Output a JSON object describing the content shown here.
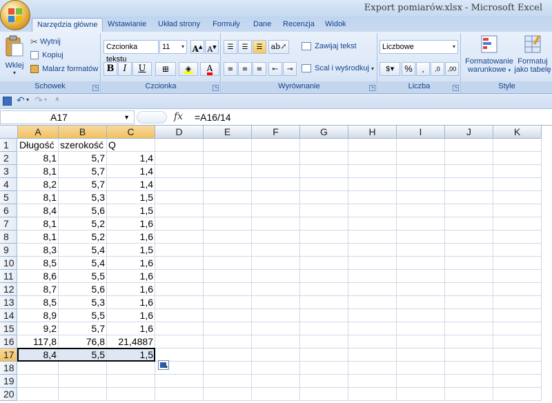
{
  "window": {
    "title": "Export pomiarów.xlsx - Microsoft Excel"
  },
  "tabs": [
    "Narzędzia główne",
    "Wstawianie",
    "Układ strony",
    "Formuły",
    "Dane",
    "Recenzja",
    "Widok"
  ],
  "ribbon": {
    "clipboard": {
      "paste": "Wklej",
      "cut": "Wytnij",
      "copy": "Kopiuj",
      "format_painter": "Malarz formatów",
      "label": "Schowek"
    },
    "font": {
      "name": "Czcionka tekstu",
      "size": "11",
      "label": "Czcionka",
      "bold": "B",
      "italic": "I",
      "underline": "U"
    },
    "alignment": {
      "wrap": "Zawijaj tekst",
      "merge": "Scal i wyśrodkuj",
      "label": "Wyrównanie"
    },
    "number": {
      "format": "Liczbowe",
      "percent": "%",
      "label": "Liczba"
    },
    "styles": {
      "conditional_line1": "Formatowanie",
      "conditional_line2": "warunkowe",
      "table_line1": "Formatuj",
      "table_line2": "jako tabelę",
      "label": "Style"
    }
  },
  "formula_bar": {
    "cell_ref": "A17",
    "fx": "fx",
    "formula": "=A16/14"
  },
  "columns": [
    "A",
    "B",
    "C",
    "D",
    "E",
    "F",
    "G",
    "H",
    "I",
    "J",
    "K"
  ],
  "rows": [
    {
      "n": "1",
      "a": "Długość",
      "b": "szerokość",
      "c": "Q"
    },
    {
      "n": "2",
      "a": "8,1",
      "b": "5,7",
      "c": "1,4"
    },
    {
      "n": "3",
      "a": "8,1",
      "b": "5,7",
      "c": "1,4"
    },
    {
      "n": "4",
      "a": "8,2",
      "b": "5,7",
      "c": "1,4"
    },
    {
      "n": "5",
      "a": "8,1",
      "b": "5,3",
      "c": "1,5"
    },
    {
      "n": "6",
      "a": "8,4",
      "b": "5,6",
      "c": "1,5"
    },
    {
      "n": "7",
      "a": "8,1",
      "b": "5,2",
      "c": "1,6"
    },
    {
      "n": "8",
      "a": "8,1",
      "b": "5,2",
      "c": "1,6"
    },
    {
      "n": "9",
      "a": "8,3",
      "b": "5,4",
      "c": "1,5"
    },
    {
      "n": "10",
      "a": "8,5",
      "b": "5,4",
      "c": "1,6"
    },
    {
      "n": "11",
      "a": "8,6",
      "b": "5,5",
      "c": "1,6"
    },
    {
      "n": "12",
      "a": "8,7",
      "b": "5,6",
      "c": "1,6"
    },
    {
      "n": "13",
      "a": "8,5",
      "b": "5,3",
      "c": "1,6"
    },
    {
      "n": "14",
      "a": "8,9",
      "b": "5,5",
      "c": "1,6"
    },
    {
      "n": "15",
      "a": "9,2",
      "b": "5,7",
      "c": "1,6"
    },
    {
      "n": "16",
      "a": "117,8",
      "b": "76,8",
      "c": "21,4887"
    },
    {
      "n": "17",
      "a": "8,4",
      "b": "5,5",
      "c": "1,5"
    },
    {
      "n": "18",
      "a": "",
      "b": "",
      "c": ""
    },
    {
      "n": "19",
      "a": "",
      "b": "",
      "c": ""
    },
    {
      "n": "20",
      "a": "",
      "b": "",
      "c": ""
    }
  ],
  "selection": {
    "row": "17"
  }
}
